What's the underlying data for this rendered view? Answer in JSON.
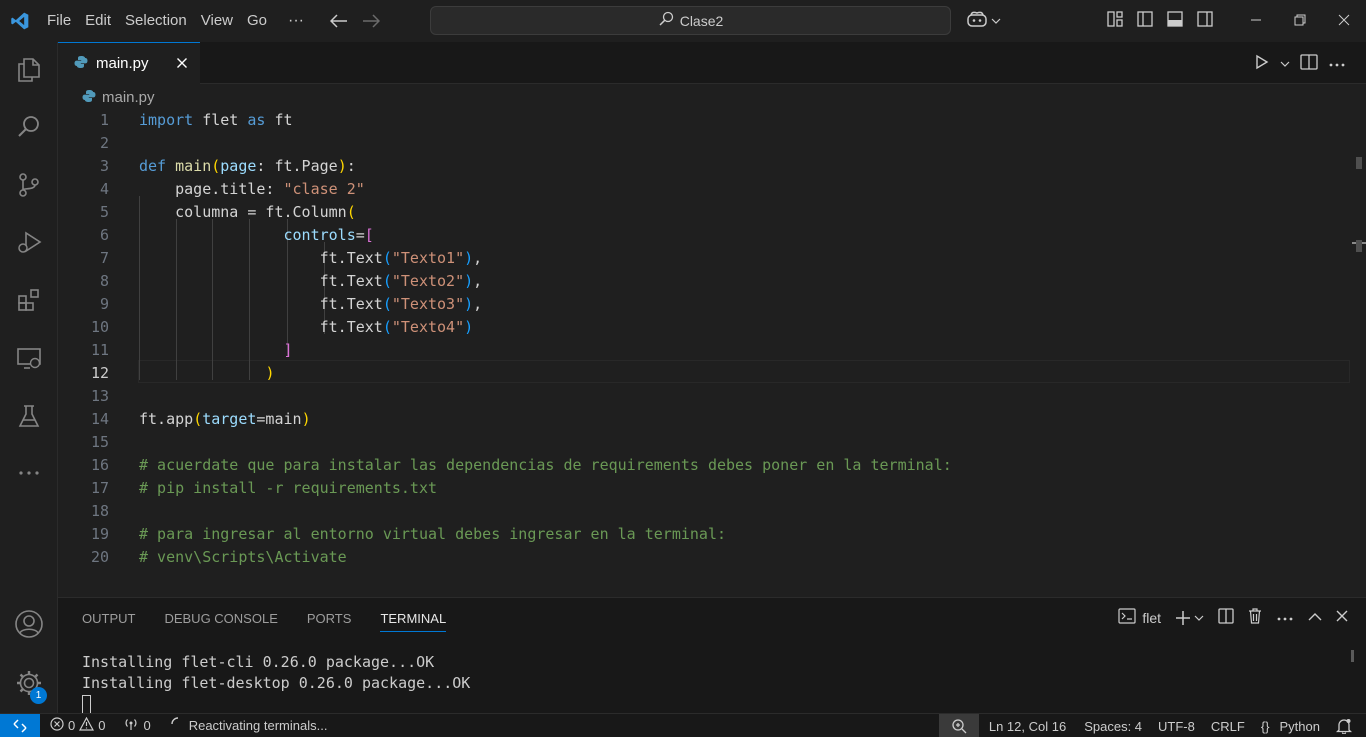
{
  "window": {
    "search_text": "Clase2"
  },
  "menu": [
    "File",
    "Edit",
    "Selection",
    "View",
    "Go"
  ],
  "menu_more": "···",
  "tab": {
    "label": "main.py",
    "close": "×"
  },
  "breadcrumb": {
    "file": "main.py"
  },
  "editor": {
    "active_line": 12,
    "line_numbers": [
      "1",
      "2",
      "3",
      "4",
      "5",
      "6",
      "7",
      "8",
      "9",
      "10",
      "11",
      "12",
      "13",
      "14",
      "15",
      "16",
      "17",
      "18",
      "19",
      "20"
    ],
    "lines": [
      [
        [
          "kw",
          "import"
        ],
        [
          "plain",
          " flet "
        ],
        [
          "kw",
          "as"
        ],
        [
          "plain",
          " ft"
        ]
      ],
      [],
      [
        [
          "kw",
          "def"
        ],
        [
          "plain",
          " "
        ],
        [
          "fn",
          "main"
        ],
        [
          "b1",
          "("
        ],
        [
          "var",
          "page"
        ],
        [
          "plain",
          ": ft.Page"
        ],
        [
          "b1",
          ")"
        ],
        [
          "plain",
          ":"
        ]
      ],
      [
        [
          "plain",
          "    page.title: "
        ],
        [
          "str",
          "\"clase 2\""
        ]
      ],
      [
        [
          "plain",
          "    columna = ft.Column"
        ],
        [
          "b1",
          "("
        ]
      ],
      [
        [
          "plain",
          "                "
        ],
        [
          "var",
          "controls"
        ],
        [
          "plain",
          "="
        ],
        [
          "b2",
          "["
        ]
      ],
      [
        [
          "plain",
          "                    ft.Text"
        ],
        [
          "b3",
          "("
        ],
        [
          "str",
          "\"Texto1\""
        ],
        [
          "b3",
          ")"
        ],
        [
          "plain",
          ","
        ]
      ],
      [
        [
          "plain",
          "                    ft.Text"
        ],
        [
          "b3",
          "("
        ],
        [
          "str",
          "\"Texto2\""
        ],
        [
          "b3",
          ")"
        ],
        [
          "plain",
          ","
        ]
      ],
      [
        [
          "plain",
          "                    ft.Text"
        ],
        [
          "b3",
          "("
        ],
        [
          "str",
          "\"Texto3\""
        ],
        [
          "b3",
          ")"
        ],
        [
          "plain",
          ","
        ]
      ],
      [
        [
          "plain",
          "                    ft.Text"
        ],
        [
          "b3",
          "("
        ],
        [
          "str",
          "\"Texto4\""
        ],
        [
          "b3",
          ")"
        ]
      ],
      [
        [
          "plain",
          "                "
        ],
        [
          "b2",
          "]"
        ]
      ],
      [
        [
          "plain",
          "              "
        ],
        [
          "b1",
          ")"
        ]
      ],
      [],
      [
        [
          "plain",
          "ft.app"
        ],
        [
          "b1",
          "("
        ],
        [
          "var",
          "target"
        ],
        [
          "plain",
          "=main"
        ],
        [
          "b1",
          ")"
        ]
      ],
      [],
      [
        [
          "cmt",
          "# acuerdate que para instalar las dependencias de requirements debes poner en la terminal:"
        ]
      ],
      [
        [
          "cmt",
          "# pip install -r requirements.txt"
        ]
      ],
      [],
      [
        [
          "cmt",
          "# para ingresar al entorno virtual debes ingresar en la terminal:"
        ]
      ],
      [
        [
          "cmt",
          "# venv\\Scripts\\Activate"
        ]
      ]
    ]
  },
  "panel": {
    "tabs": [
      "OUTPUT",
      "DEBUG CONSOLE",
      "PORTS",
      "TERMINAL"
    ],
    "active_tab": "TERMINAL",
    "terminal_name": "flet",
    "terminal_lines": [
      "Installing flet-cli 0.26.0 package...OK",
      "Installing flet-desktop 0.26.0 package...OK"
    ]
  },
  "statusbar": {
    "errors": "0",
    "warnings": "0",
    "ports": "0",
    "task": "Reactivating terminals...",
    "position": "Ln 12, Col 16",
    "spaces": "Spaces: 4",
    "encoding": "UTF-8",
    "eol": "CRLF",
    "language_brace": "{}",
    "language": "Python"
  },
  "activity": {
    "accounts_badge": "1"
  },
  "colors": {
    "accent": "#0078d4",
    "background": "#1f1f1f"
  }
}
